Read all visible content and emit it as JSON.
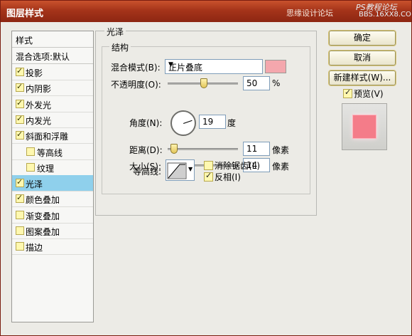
{
  "window": {
    "title": "图层样式",
    "watermark_left": "思缘设计论坛",
    "watermark_right_top": "PS教程论坛",
    "watermark_right_bottom": "BBS.16XX8.COM"
  },
  "left_panel": {
    "header": "样式",
    "blend_options": "混合选项:默认",
    "items": [
      {
        "label": "投影",
        "checked": true,
        "indent": false,
        "selected": false
      },
      {
        "label": "内阴影",
        "checked": true,
        "indent": false,
        "selected": false
      },
      {
        "label": "外发光",
        "checked": true,
        "indent": false,
        "selected": false
      },
      {
        "label": "内发光",
        "checked": true,
        "indent": false,
        "selected": false
      },
      {
        "label": "斜面和浮雕",
        "checked": true,
        "indent": false,
        "selected": false
      },
      {
        "label": "等高线",
        "checked": false,
        "indent": true,
        "selected": false
      },
      {
        "label": "纹理",
        "checked": false,
        "indent": true,
        "selected": false
      },
      {
        "label": "光泽",
        "checked": true,
        "indent": false,
        "selected": true
      },
      {
        "label": "颜色叠加",
        "checked": true,
        "indent": false,
        "selected": false
      },
      {
        "label": "渐变叠加",
        "checked": false,
        "indent": false,
        "selected": false
      },
      {
        "label": "图案叠加",
        "checked": false,
        "indent": false,
        "selected": false
      },
      {
        "label": "描边",
        "checked": false,
        "indent": false,
        "selected": false
      }
    ]
  },
  "satin": {
    "title": "光泽",
    "structure_title": "结构",
    "blend_mode_label": "混合模式(B):",
    "blend_mode_value": "正片叠底",
    "blend_color": "#f4a7ad",
    "opacity_label": "不透明度(O):",
    "opacity_value": "50",
    "opacity_unit": "%",
    "opacity_fraction": 0.5,
    "angle_label": "角度(N):",
    "angle_value": "19",
    "angle_unit": "度",
    "distance_label": "距离(D):",
    "distance_value": "11",
    "distance_unit": "像素",
    "size_label": "大小(S):",
    "size_value": "14",
    "size_unit": "像素",
    "contour_label": "等高线:",
    "antialias_label": "消除锯齿(L)",
    "antialias_checked": false,
    "invert_label": "反相(I)",
    "invert_checked": true
  },
  "right": {
    "ok_label": "确定",
    "cancel_label": "取消",
    "new_style_label": "新建样式(W)...",
    "preview_label": "预览(V)",
    "preview_checked": true
  }
}
